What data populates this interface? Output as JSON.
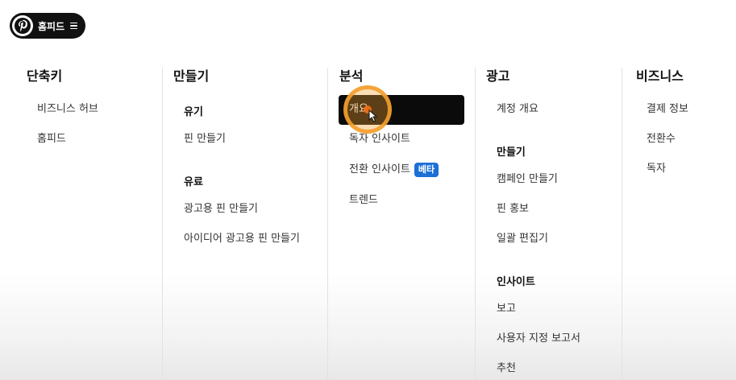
{
  "header": {
    "home_label": "홈피드",
    "logo_icon": "pinterest-logo-icon",
    "menu_icon": "hamburger-menu-icon"
  },
  "columns": {
    "shortcuts": {
      "title": "단축키",
      "items": [
        "비즈니스 허브",
        "홈피드"
      ]
    },
    "create": {
      "title": "만들기",
      "sections": [
        {
          "heading": "유기",
          "items": [
            "핀 만들기"
          ]
        },
        {
          "heading": "유료",
          "items": [
            "광고용 핀 만들기",
            "아이디어 광고용 핀 만들기"
          ]
        }
      ]
    },
    "analytics": {
      "title": "분석",
      "items": [
        "개요",
        "독자 인사이트",
        "전환 인사이트",
        "트렌드"
      ],
      "selected_item": "개요",
      "beta_badge": "베타"
    },
    "ads": {
      "title": "광고",
      "items": [
        "계정 개요"
      ],
      "sections": [
        {
          "heading": "만들기",
          "items": [
            "캠페인 만들기",
            "핀 홍보",
            "일괄 편집기"
          ]
        },
        {
          "heading": "인사이트",
          "items": [
            "보고",
            "사용자 지정 보고서",
            "추천"
          ]
        }
      ]
    },
    "business": {
      "title": "비즈니스",
      "items": [
        "결제 정보",
        "전환수",
        "독자"
      ]
    }
  },
  "colors": {
    "pill_background": "#111111",
    "selected_background": "#0b0b0b",
    "beta_badge": "#1c6fd6",
    "click_highlight": "#f5a02d"
  }
}
